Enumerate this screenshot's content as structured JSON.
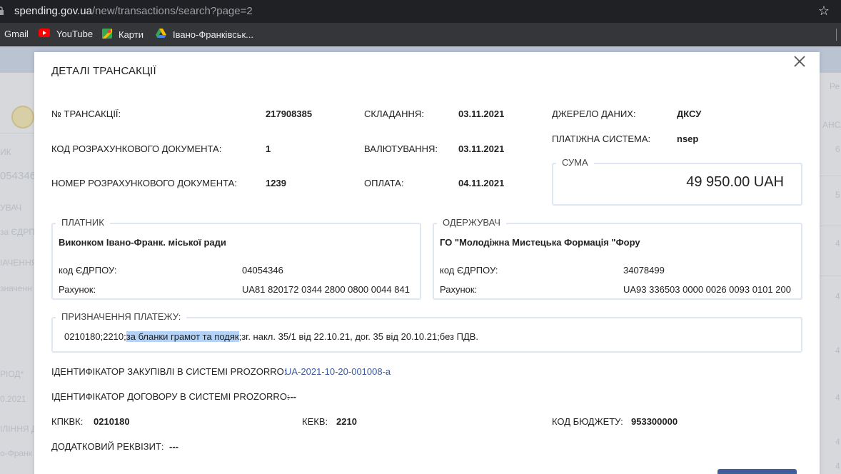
{
  "browser": {
    "url_host": "spending.gov.ua",
    "url_path": "/new/transactions/search?page=2",
    "bookmarks": [
      {
        "label": "Gmail",
        "icon": "gmail-icon"
      },
      {
        "label": "YouTube",
        "icon": "youtube-icon"
      },
      {
        "label": "Карти",
        "icon": "maps-icon"
      },
      {
        "label": "Івано-Франківськ...",
        "icon": "drive-icon"
      }
    ]
  },
  "background": {
    "texts": [
      "ИК",
      "054346",
      "УВАЧ",
      "за ЄДРП",
      "ІАЧЕННЯ",
      "значенн",
      "РІОД*",
      "0.2021",
      "ІЛІННЯ Д",
      "о-Франк",
      "Ре",
      "АНСА",
      "6",
      "5",
      "4",
      "4",
      "4",
      "4",
      "4",
      "4"
    ]
  },
  "modal": {
    "title": "ДЕТАЛІ ТРАНСАКЦІЇ",
    "transaction_no_label": "№ ТРАНСАКЦІЇ:",
    "transaction_no": "217908385",
    "doc_code_label": "КОД РОЗРАХУНКОВОГО ДОКУМЕНТА:",
    "doc_code": "1",
    "doc_number_label": "НОМЕР РОЗРАХУНКОВОГО ДОКУМЕНТА:",
    "doc_number": "1239",
    "compiled_label": "СКЛАДАННЯ:",
    "compiled": "03.11.2021",
    "valuation_label": "ВАЛЮТУВАННЯ:",
    "valuation": "03.11.2021",
    "payment_label": "ОПЛАТА:",
    "payment": "04.11.2021",
    "source_label": "ДЖЕРЕЛО ДАНИХ:",
    "source": "ДКСУ",
    "paysys_label": "ПЛАТІЖНА СИСТЕМА:",
    "paysys": "nsep",
    "sum_legend": "СУМА",
    "sum": "49 950.00 UAH",
    "payer": {
      "legend": "ПЛАТНИК",
      "name": "Виконком Івано-Франк. міської ради",
      "edrpou_label": "код ЄДРПОУ:",
      "edrpou": "04054346",
      "account_label": "Рахунок:",
      "account": "UA81 820172 0344 2800 0800 0044 841"
    },
    "recipient": {
      "legend": "ОДЕРЖУВАЧ",
      "name": "ГО \"Молодіжна Мистецька Формація \"Фору",
      "edrpou_label": "код ЄДРПОУ:",
      "edrpou": "34078499",
      "account_label": "Рахунок:",
      "account": "UA93 336503 0000 0026 0093 0101 200"
    },
    "purpose": {
      "legend": "ПРИЗНАЧЕННЯ ПЛАТЕЖУ:",
      "text_before": "0210180;2210;",
      "text_selected": "за бланки грамот та подяк",
      "text_after": ";зг. накл. 35/1 від 22.10.21, дог. 35 від 20.10.21;без ПДВ."
    },
    "prozorro_purchase_label": "ІДЕНТИФІКАТОР ЗАКУПІВЛІ В СИСТЕМІ PROZORRO:",
    "prozorro_purchase": "UA-2021-10-20-001008-a",
    "prozorro_contract_label": "ІДЕНТИФІКАТОР ДОГОВОРУ В СИСТЕМІ PROZORRO:",
    "prozorro_contract": "---",
    "kpkvk_label": "КПКВК:",
    "kpkvk": "0210180",
    "kekv_label": "КЕКВ:",
    "kekv": "2210",
    "budget_code_label": "КОД БЮДЖЕТУ:",
    "budget_code": "953300000",
    "extra_label": "ДОДАТКОВИЙ РЕКВІЗИТ:",
    "extra": "---"
  }
}
